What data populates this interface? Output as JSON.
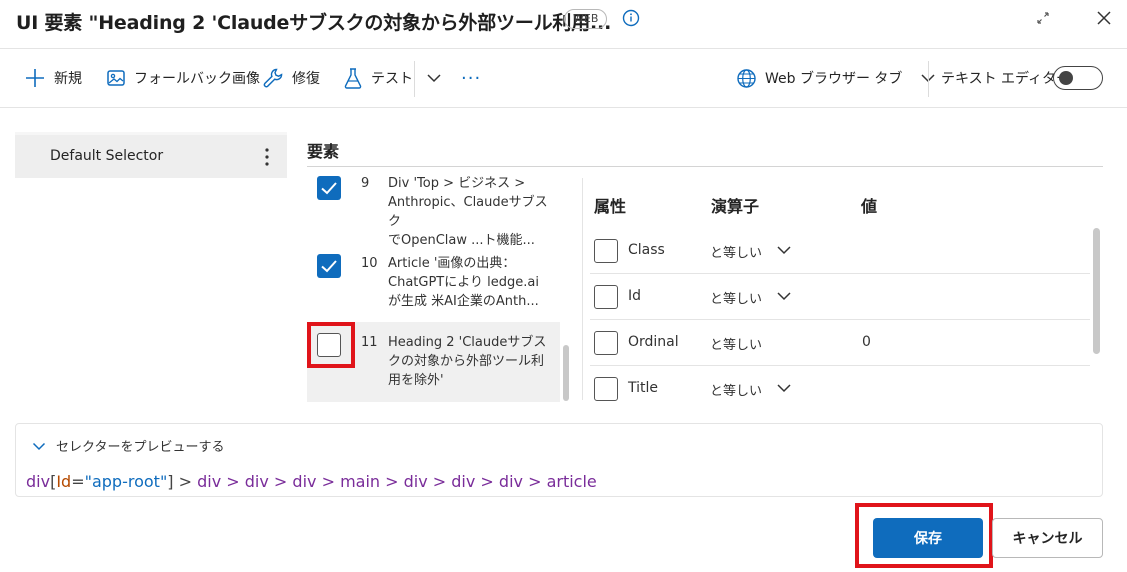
{
  "dialog": {
    "title": "UI 要素 \"Heading 2 'Claudeサブスクの対象から外部ツール利用...",
    "badge": "WEB"
  },
  "toolbar": {
    "new_label": "新規",
    "fallback_label": "フォールバック画像",
    "repair_label": "修復",
    "test_label": "テスト",
    "more_label": "···",
    "browser_label": "Web ブラウザー タブ",
    "text_editor_label": "テキスト エディター",
    "text_editor_on": false
  },
  "selectors": [
    {
      "label": "Default Selector"
    }
  ],
  "elements": {
    "heading": "要素",
    "items": [
      {
        "num": "9",
        "text": "Div 'Top > ビジネス >\nAnthropic、Claudeサブスク\nでOpenClaw ...ト機能...",
        "checked": true
      },
      {
        "num": "10",
        "text": "Article '画像の出典：\nChatGPTにより ledge.ai\nが生成 米AI企業のAnth...",
        "checked": true
      },
      {
        "num": "11",
        "text": "Heading 2 'Claudeサブス\nクの対象から外部ツール利\n用を除外'",
        "checked": false
      }
    ]
  },
  "attributes": {
    "col_attr": "属性",
    "col_op": "演算子",
    "col_val": "値",
    "rows": [
      {
        "name": "Class",
        "op": "と等しい",
        "value": ""
      },
      {
        "name": "Id",
        "op": "と等しい",
        "value": ""
      },
      {
        "name": "Ordinal",
        "op": "と等しい",
        "value": "0"
      },
      {
        "name": "Title",
        "op": "と等しい",
        "value": ""
      }
    ]
  },
  "preview": {
    "toggle_label": "セレクターをプレビューする",
    "path": {
      "root_tag": "div",
      "attr_name": "Id",
      "attr_value": "\"app-root\"",
      "tail": "div > div > div > main > div > div > div > article"
    }
  },
  "buttons": {
    "save": "保存",
    "cancel": "キャンセル"
  },
  "colors": {
    "accent": "#0f6cbd",
    "highlight": "#e0141a"
  }
}
